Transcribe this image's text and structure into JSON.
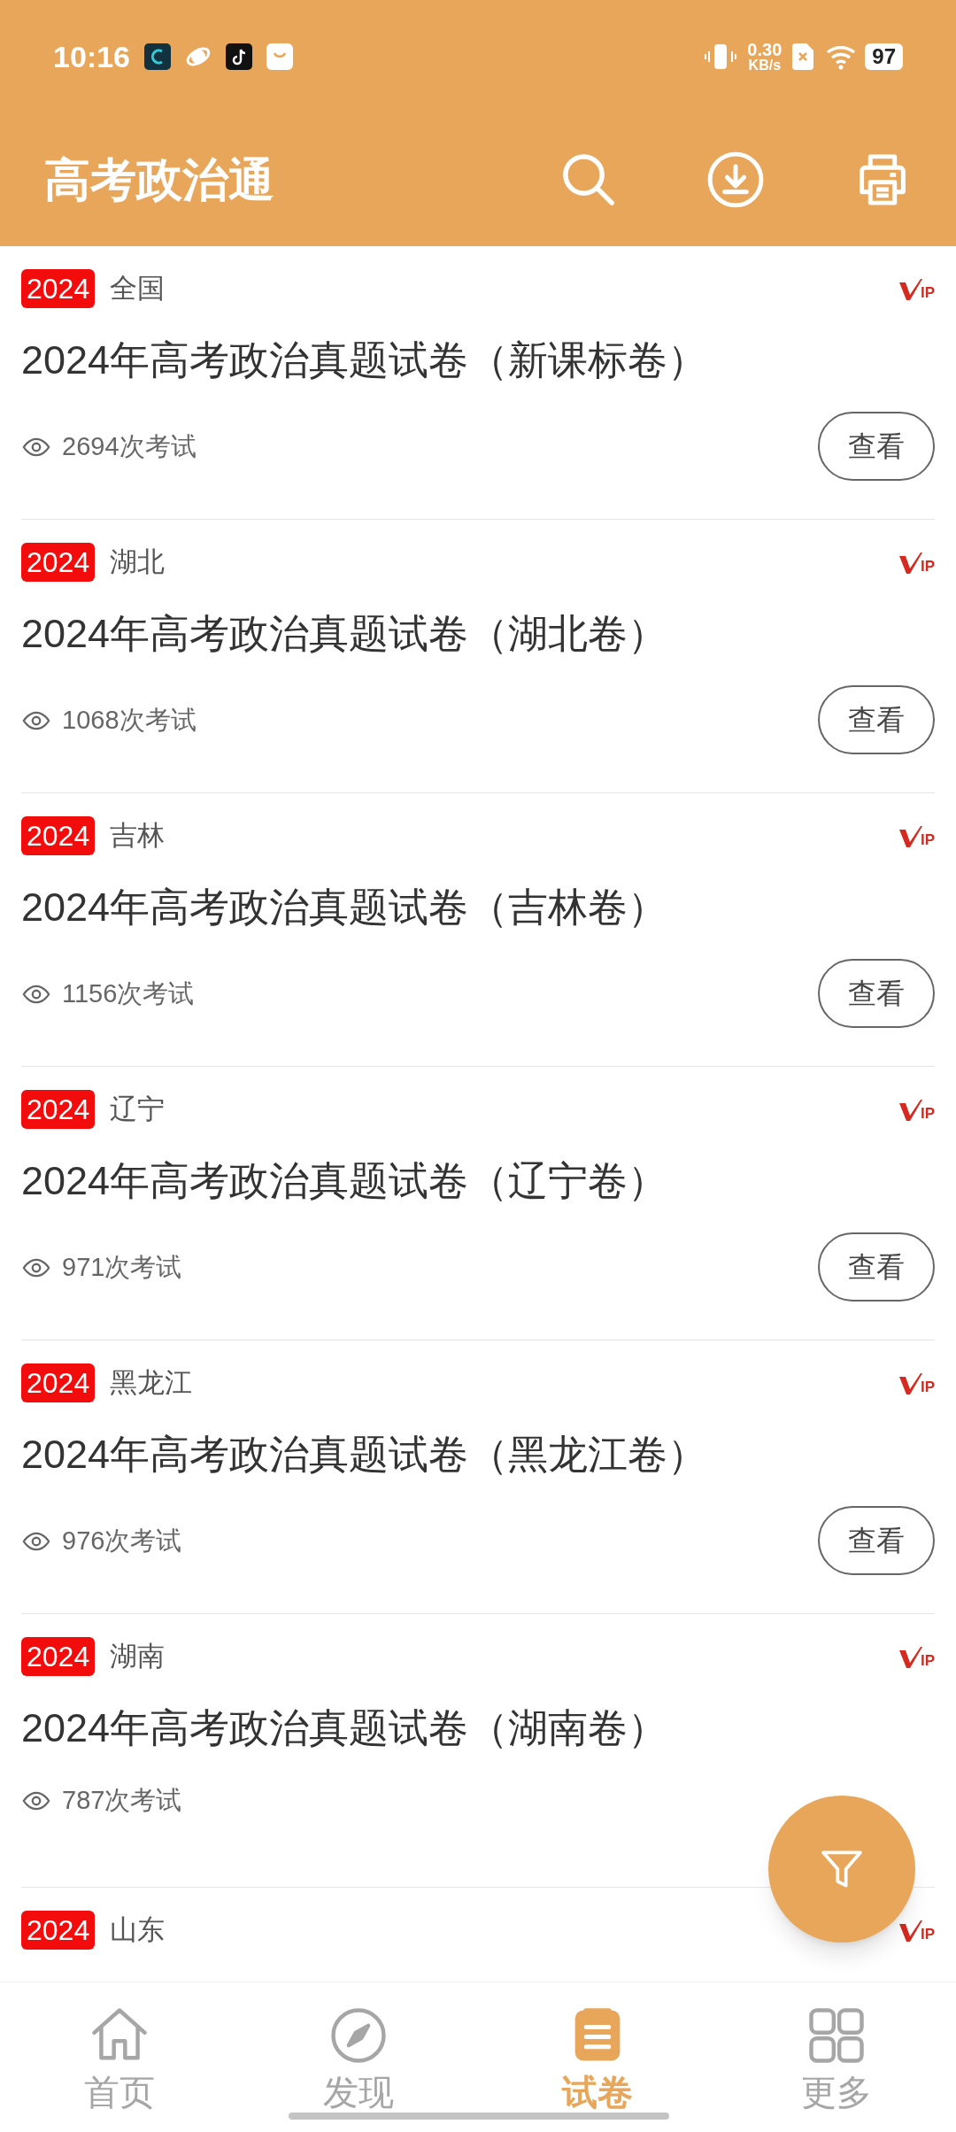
{
  "status_bar": {
    "time": "10:16",
    "speed_value": "0.30",
    "speed_unit": "KB/s",
    "battery": "97"
  },
  "app_bar": {
    "title": "高考政治通"
  },
  "papers": [
    {
      "year": "2024",
      "region": "全国",
      "vip": "IP",
      "title": "2024年高考政治真题试卷（新课标卷）",
      "views": "2694次考试",
      "action": "查看"
    },
    {
      "year": "2024",
      "region": "湖北",
      "vip": "IP",
      "title": "2024年高考政治真题试卷（湖北卷）",
      "views": "1068次考试",
      "action": "查看"
    },
    {
      "year": "2024",
      "region": "吉林",
      "vip": "IP",
      "title": "2024年高考政治真题试卷（吉林卷）",
      "views": "1156次考试",
      "action": "查看"
    },
    {
      "year": "2024",
      "region": "辽宁",
      "vip": "IP",
      "title": "2024年高考政治真题试卷（辽宁卷）",
      "views": "971次考试",
      "action": "查看"
    },
    {
      "year": "2024",
      "region": "黑龙江",
      "vip": "IP",
      "title": "2024年高考政治真题试卷（黑龙江卷）",
      "views": "976次考试",
      "action": "查看"
    },
    {
      "year": "2024",
      "region": "湖南",
      "vip": "IP",
      "title": "2024年高考政治真题试卷（湖南卷）",
      "views": "787次考试"
    },
    {
      "year": "2024",
      "region": "山东",
      "vip": "IP"
    }
  ],
  "bottom_nav": [
    {
      "kind": "home",
      "label": "首页",
      "selected": false
    },
    {
      "kind": "discover",
      "label": "发现",
      "selected": false
    },
    {
      "kind": "papers",
      "label": "试卷",
      "selected": true
    },
    {
      "kind": "more",
      "label": "更多",
      "selected": false
    }
  ]
}
